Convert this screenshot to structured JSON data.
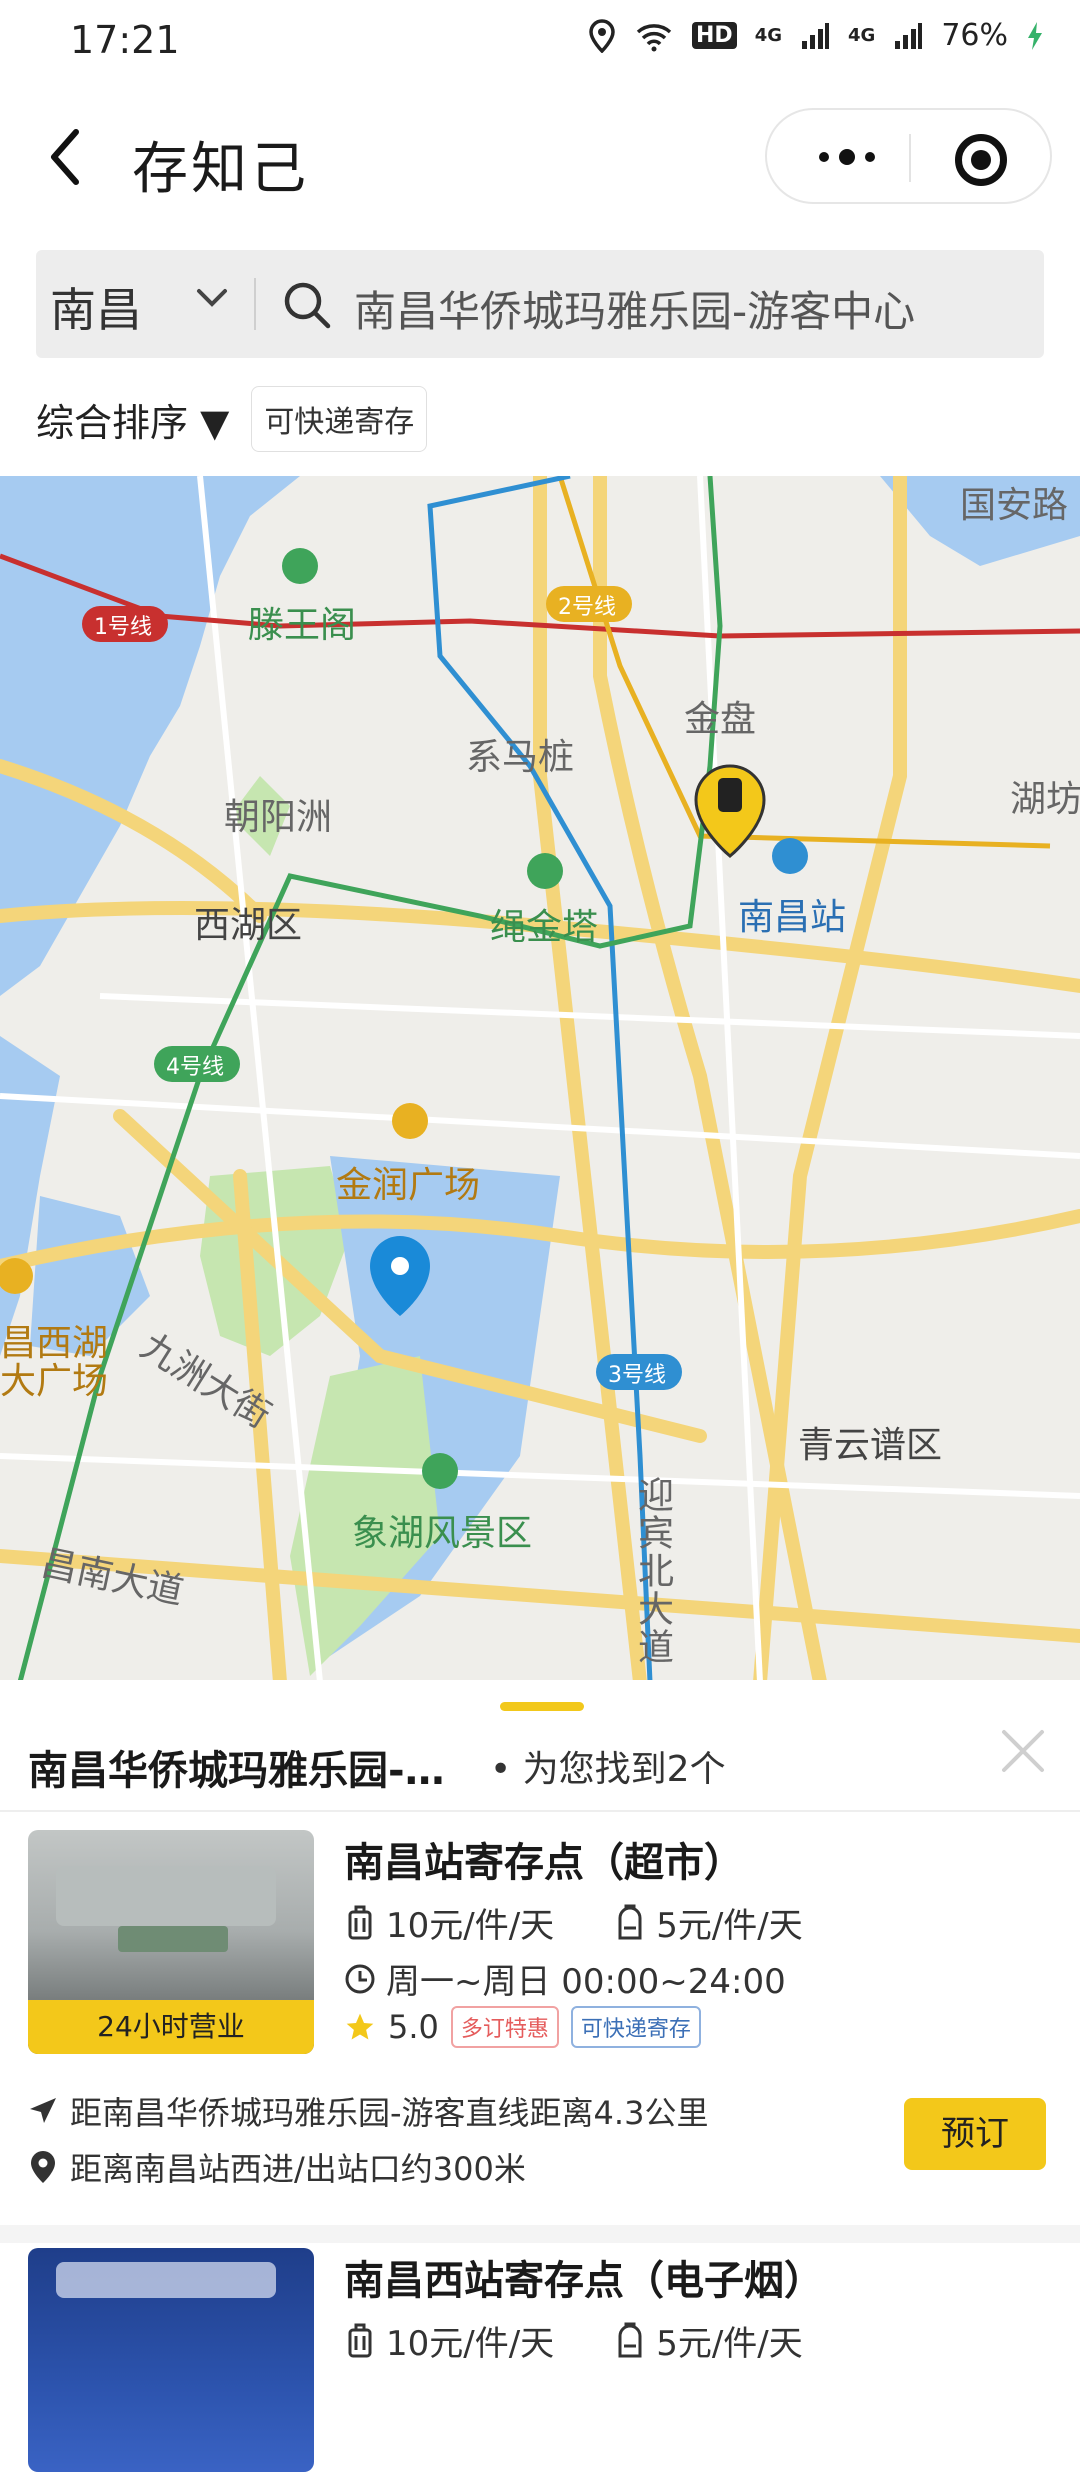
{
  "status_bar": {
    "time": "17:21",
    "network": "HD",
    "signal1": "4G",
    "signal2": "4G",
    "battery": "76%"
  },
  "nav": {
    "title": "存知己"
  },
  "search": {
    "city": "南昌",
    "query": "南昌华侨城玛雅乐园-游客中心"
  },
  "filters": {
    "sort": "综合排序 ▼",
    "chip": "可快递寄存"
  },
  "map": {
    "labels": {
      "line1": "1号线",
      "line2": "2号线",
      "line3": "3号线",
      "line4": "4号线",
      "tengwangge": "滕王阁",
      "guoanlu": "国安路",
      "jinpan": "金盘",
      "ximazhuang": "系马桩",
      "chaoyangzhou": "朝阳洲",
      "hufang": "湖坊",
      "xihuqu": "西湖区",
      "shengjinta": "绳金塔",
      "nanchangzhan": "南昌站",
      "jinrunguangchang": "金润广场",
      "jiuzhoudajie": "九洲大街",
      "xihudaguangchang1": "昌西湖",
      "xihudaguangchang2": "大广场",
      "qingyunpuqu": "青云谱区",
      "xianghufengjingqu": "象湖风景区",
      "changnandadao": "昌南大道",
      "yingbinbeidadao": "迎宾北大道"
    }
  },
  "sheet": {
    "location": "南昌华侨城玛雅乐园-…",
    "found": "• 为您找到2个",
    "items": [
      {
        "badge": "24小时营业",
        "title": "南昌站寄存点（超市）",
        "price_luggage": "10元/件/天",
        "price_bag": "5元/件/天",
        "hours": "周一~周日 00:00~24:00",
        "rating": "5.0",
        "tag1": "多订特惠",
        "tag2": "可快递寄存",
        "distance": "距南昌华侨城玛雅乐园-游客直线距离4.3公里",
        "entrance": "距离南昌站西进/出站口约300米",
        "book": "预订"
      },
      {
        "title": "南昌西站寄存点（电子烟）",
        "price_luggage": "10元/件/天",
        "price_bag": "5元/件/天"
      }
    ]
  },
  "colors": {
    "accent": "#f3c81a",
    "line1": "#c8302f",
    "line2": "#e8b122",
    "line3": "#2f8fd2",
    "line4": "#3fa45a"
  }
}
